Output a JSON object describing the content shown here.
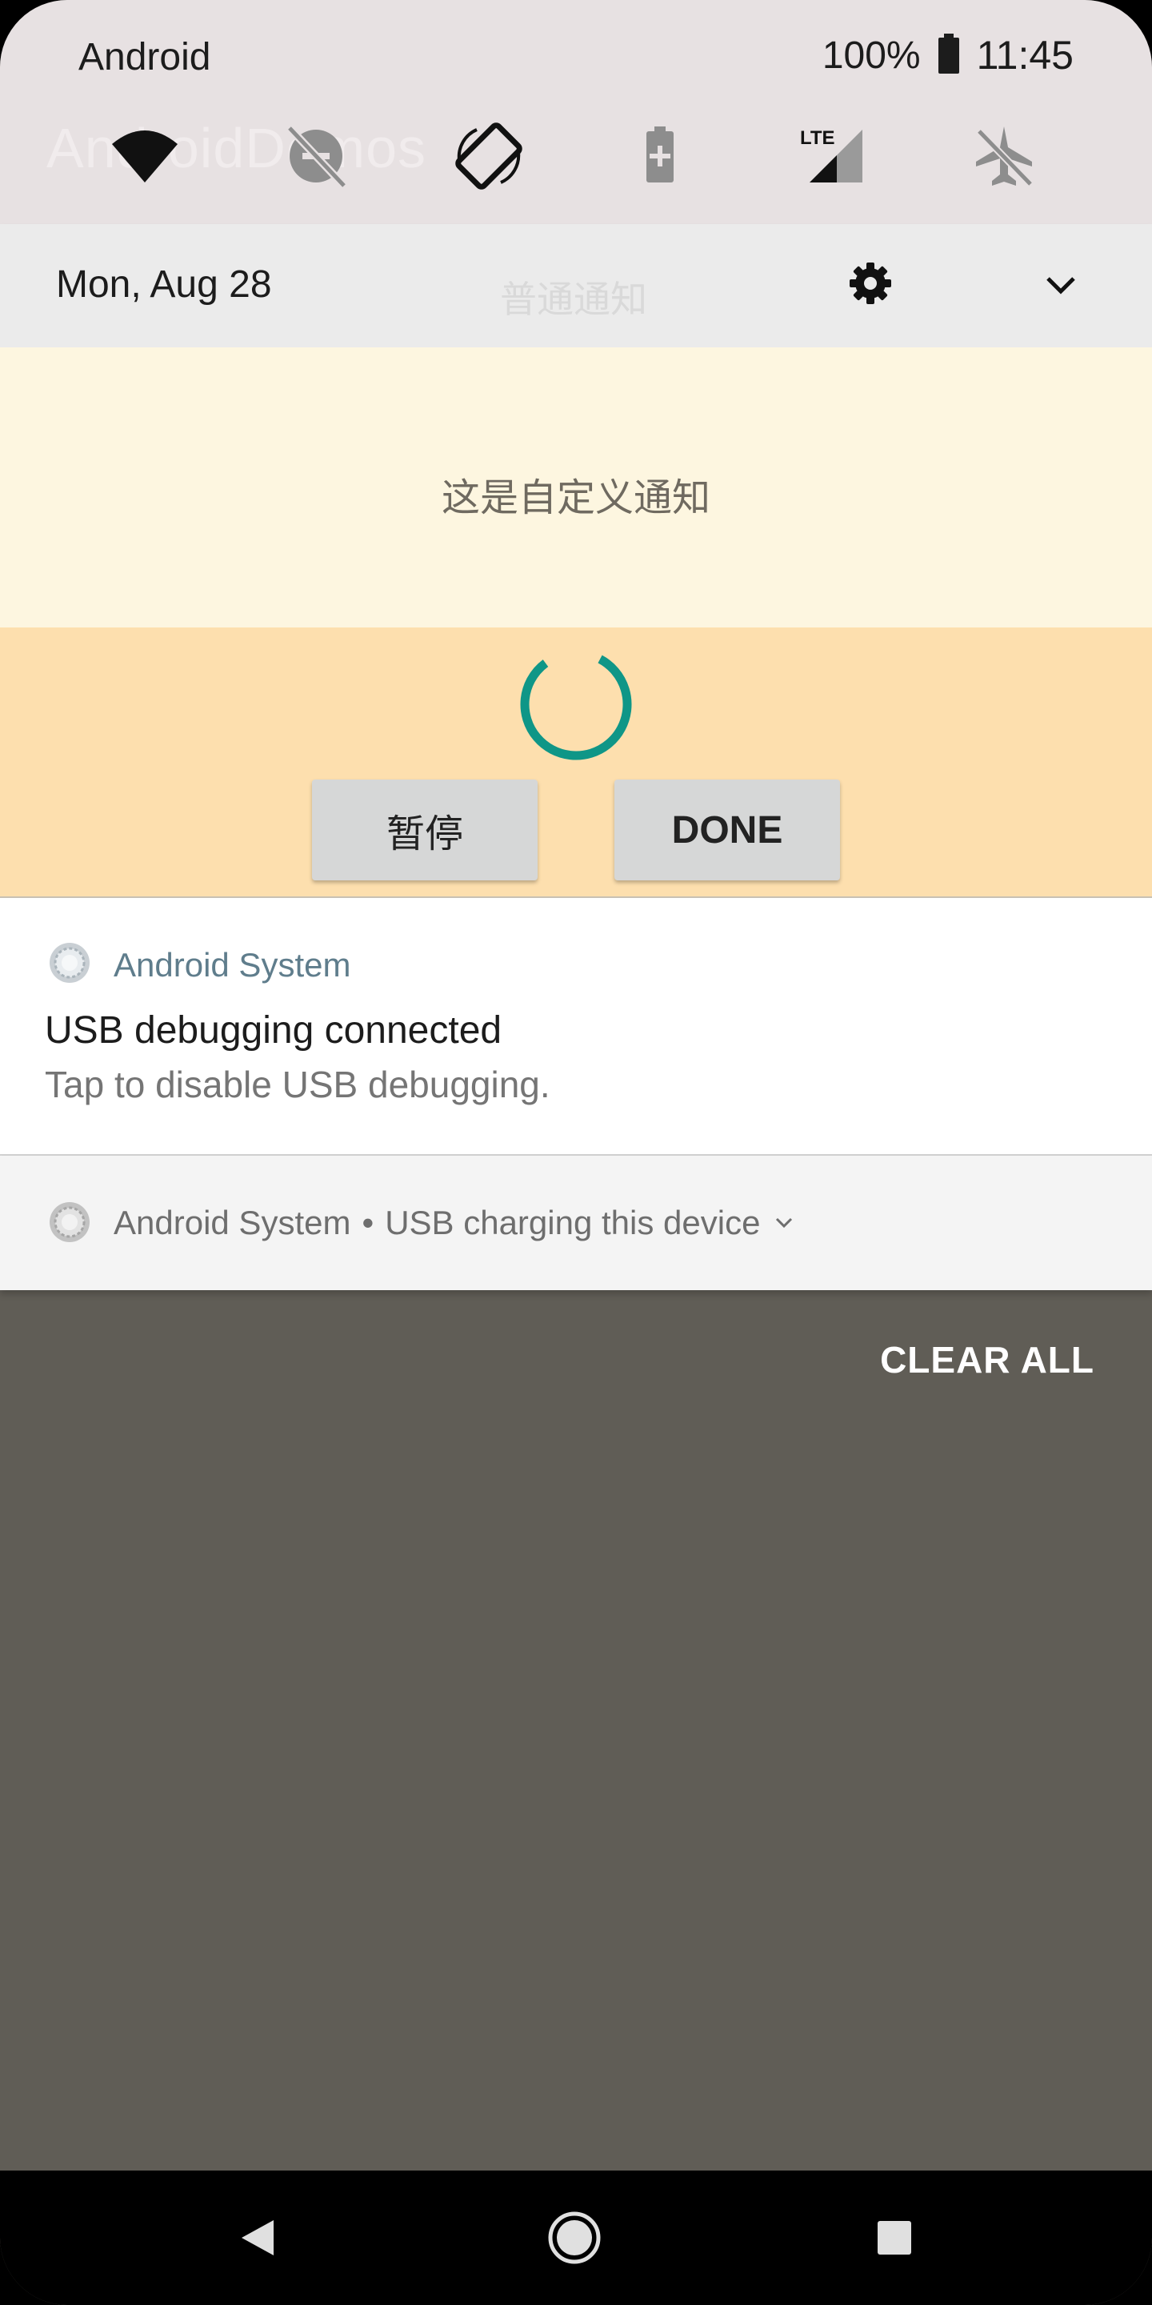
{
  "status_bar": {
    "carrier": "Android",
    "battery_percent": "100%",
    "time": "11:45"
  },
  "background_app": {
    "title": "AndroidDemos",
    "subtitle": "普通通知"
  },
  "quick_settings": {
    "tiles": [
      {
        "icon": "wifi-icon",
        "state": "on"
      },
      {
        "icon": "do-not-disturb-off-icon",
        "state": "off"
      },
      {
        "icon": "auto-rotate-icon",
        "state": "on"
      },
      {
        "icon": "battery-saver-icon",
        "state": "off"
      },
      {
        "icon": "mobile-data-lte-icon",
        "label": "LTE",
        "state": "on"
      },
      {
        "icon": "airplane-mode-off-icon",
        "state": "off"
      }
    ],
    "date": "Mon, Aug 28",
    "settings_icon": "gear-icon",
    "expand_icon": "chevron-down-icon"
  },
  "custom_notification": {
    "text": "这是自定义通知",
    "progress": "indeterminate",
    "pause_label": "暂停",
    "done_label": "DONE"
  },
  "usb_debugging": {
    "app_name": "Android System",
    "title": "USB debugging connected",
    "text": "Tap to disable USB debugging."
  },
  "usb_charging": {
    "app_name": "Android System",
    "separator": "•",
    "summary": "USB charging this device"
  },
  "clear_all_label": "CLEAR ALL",
  "navigation": {
    "back_icon": "back-triangle-icon",
    "home_icon": "home-circle-icon",
    "recents_icon": "recents-square-icon"
  },
  "colors": {
    "accent_teal": "#0f9687",
    "custom_top_bg": "#fdf6e0",
    "custom_bottom_bg": "#fddfae",
    "app_name_color": "#5f7d8c",
    "scrim": "#605d56"
  }
}
